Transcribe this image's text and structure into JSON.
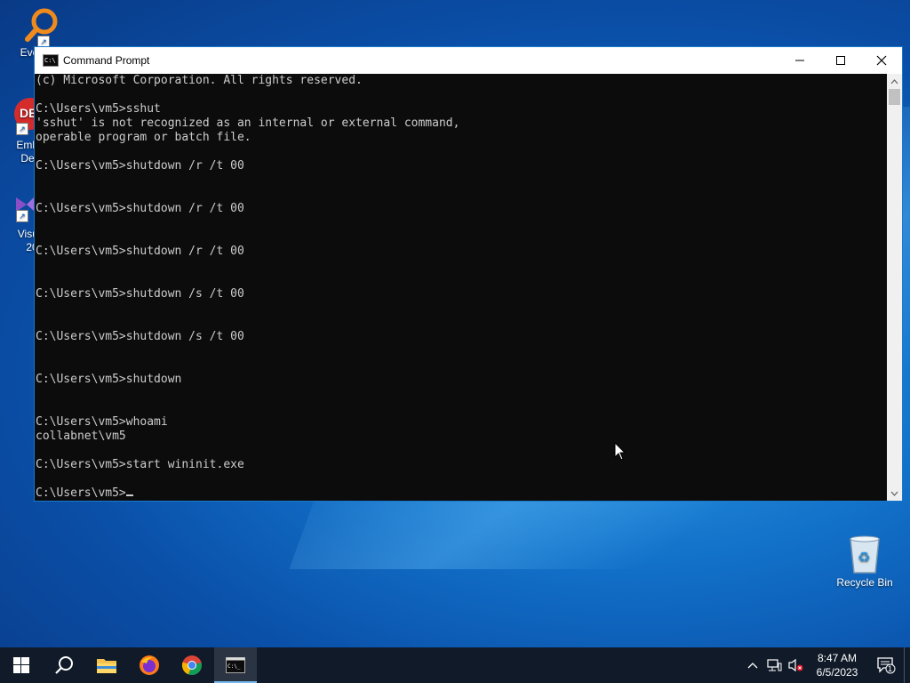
{
  "desktop": {
    "icons": [
      {
        "label": "Every"
      },
      {
        "label": "Embar\nDev-"
      },
      {
        "label": "Visual\n20"
      },
      {
        "label": "Recycle Bin"
      }
    ]
  },
  "window": {
    "title": "Command Prompt",
    "terminal_lines": [
      "(c) Microsoft Corporation. All rights reserved.",
      "",
      "C:\\Users\\vm5>sshut",
      "'sshut' is not recognized as an internal or external command,",
      "operable program or batch file.",
      "",
      "C:\\Users\\vm5>shutdown /r /t 00",
      "",
      "",
      "C:\\Users\\vm5>shutdown /r /t 00",
      "",
      "",
      "C:\\Users\\vm5>shutdown /r /t 00",
      "",
      "",
      "C:\\Users\\vm5>shutdown /s /t 00",
      "",
      "",
      "C:\\Users\\vm5>shutdown /s /t 00",
      "",
      "",
      "C:\\Users\\vm5>shutdown",
      "",
      "",
      "C:\\Users\\vm5>whoami",
      "collabnet\\vm5",
      "",
      "C:\\Users\\vm5>start wininit.exe",
      "",
      "C:\\Users\\vm5>"
    ]
  },
  "taskbar": {
    "time": "8:47 AM",
    "date": "6/5/2023",
    "notification_count": "1",
    "apps": [
      "start",
      "search",
      "file-explorer",
      "firefox",
      "chrome",
      "command-prompt"
    ]
  },
  "colors": {
    "terminal_bg": "#0c0c0c",
    "terminal_fg": "#cccccc",
    "taskbar_bg": "#101a28",
    "accent": "#76b9ed"
  }
}
